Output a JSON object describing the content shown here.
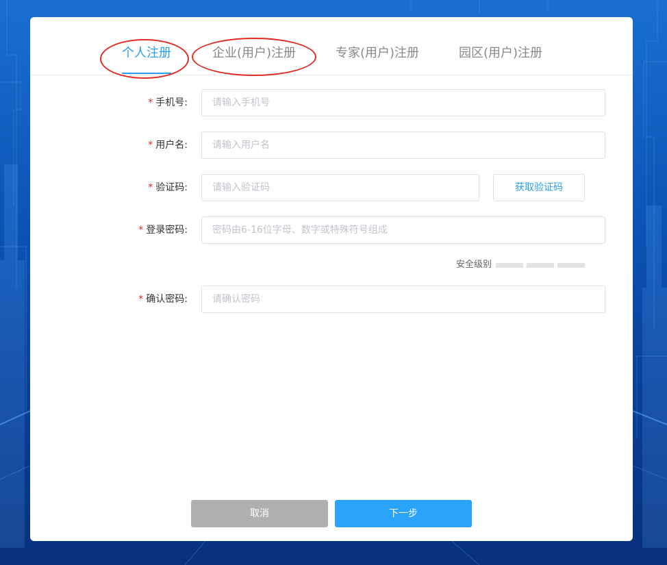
{
  "tabs": [
    {
      "label": "个人注册",
      "active": true
    },
    {
      "label": "企业(用户)注册",
      "active": false
    },
    {
      "label": "专家(用户)注册",
      "active": false
    },
    {
      "label": "园区(用户)注册",
      "active": false
    }
  ],
  "form": {
    "required_mark": "*",
    "phone": {
      "label": "手机号:",
      "placeholder": "请输入手机号"
    },
    "username": {
      "label": "用户名:",
      "placeholder": "请输入用户名"
    },
    "code": {
      "label": "验证码:",
      "placeholder": "请输入验证码",
      "button": "获取验证码"
    },
    "password": {
      "label": "登录密码:",
      "placeholder": "密码由6-16位字母、数字或特殊符号组成"
    },
    "strength": {
      "label": "安全级别",
      "level": 0,
      "max_level": 3
    },
    "confirm": {
      "label": "确认密码:",
      "placeholder": "请确认密码"
    }
  },
  "actions": {
    "cancel": "取消",
    "next": "下一步"
  },
  "colors": {
    "accent": "#2a9ff0",
    "required": "#e0291e",
    "annotation": "#e0291e",
    "cancel_bg": "#b0b0b0",
    "next_bg": "#2aa4fb"
  }
}
